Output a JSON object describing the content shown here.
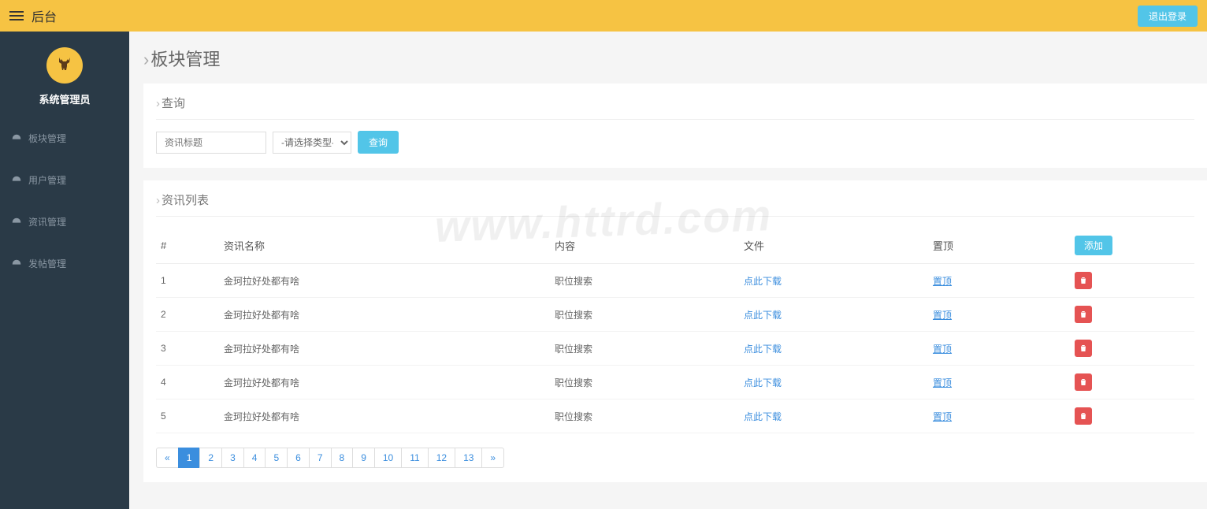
{
  "header": {
    "title": "后台",
    "logout": "退出登录"
  },
  "profile": {
    "username": "系统管理员"
  },
  "sidebar": {
    "items": [
      {
        "label": "板块管理"
      },
      {
        "label": "用户管理"
      },
      {
        "label": "资讯管理"
      },
      {
        "label": "发帖管理"
      }
    ]
  },
  "page": {
    "title": "板块管理"
  },
  "query": {
    "heading": "查询",
    "input_placeholder": "资讯标题",
    "select_placeholder": "-请选择类型-",
    "button": "查询"
  },
  "list": {
    "heading": "资讯列表",
    "add_label": "添加",
    "columns": {
      "idx": "#",
      "name": "资讯名称",
      "content": "内容",
      "file": "文件",
      "top": "置顶",
      "action": ""
    },
    "rows": [
      {
        "idx": "1",
        "name": "金珂拉好处都有啥",
        "content": "职位搜索",
        "file": "点此下载",
        "top": "置顶"
      },
      {
        "idx": "2",
        "name": "金珂拉好处都有啥",
        "content": "职位搜索",
        "file": "点此下载",
        "top": "置顶"
      },
      {
        "idx": "3",
        "name": "金珂拉好处都有啥",
        "content": "职位搜索",
        "file": "点此下载",
        "top": "置顶"
      },
      {
        "idx": "4",
        "name": "金珂拉好处都有啥",
        "content": "职位搜索",
        "file": "点此下载",
        "top": "置顶"
      },
      {
        "idx": "5",
        "name": "金珂拉好处都有啥",
        "content": "职位搜索",
        "file": "点此下载",
        "top": "置顶"
      }
    ]
  },
  "pagination": {
    "prev": "«",
    "next": "»",
    "pages": [
      "1",
      "2",
      "3",
      "4",
      "5",
      "6",
      "7",
      "8",
      "9",
      "10",
      "11",
      "12",
      "13"
    ],
    "active": "1"
  },
  "watermark": "www.httrd.com"
}
